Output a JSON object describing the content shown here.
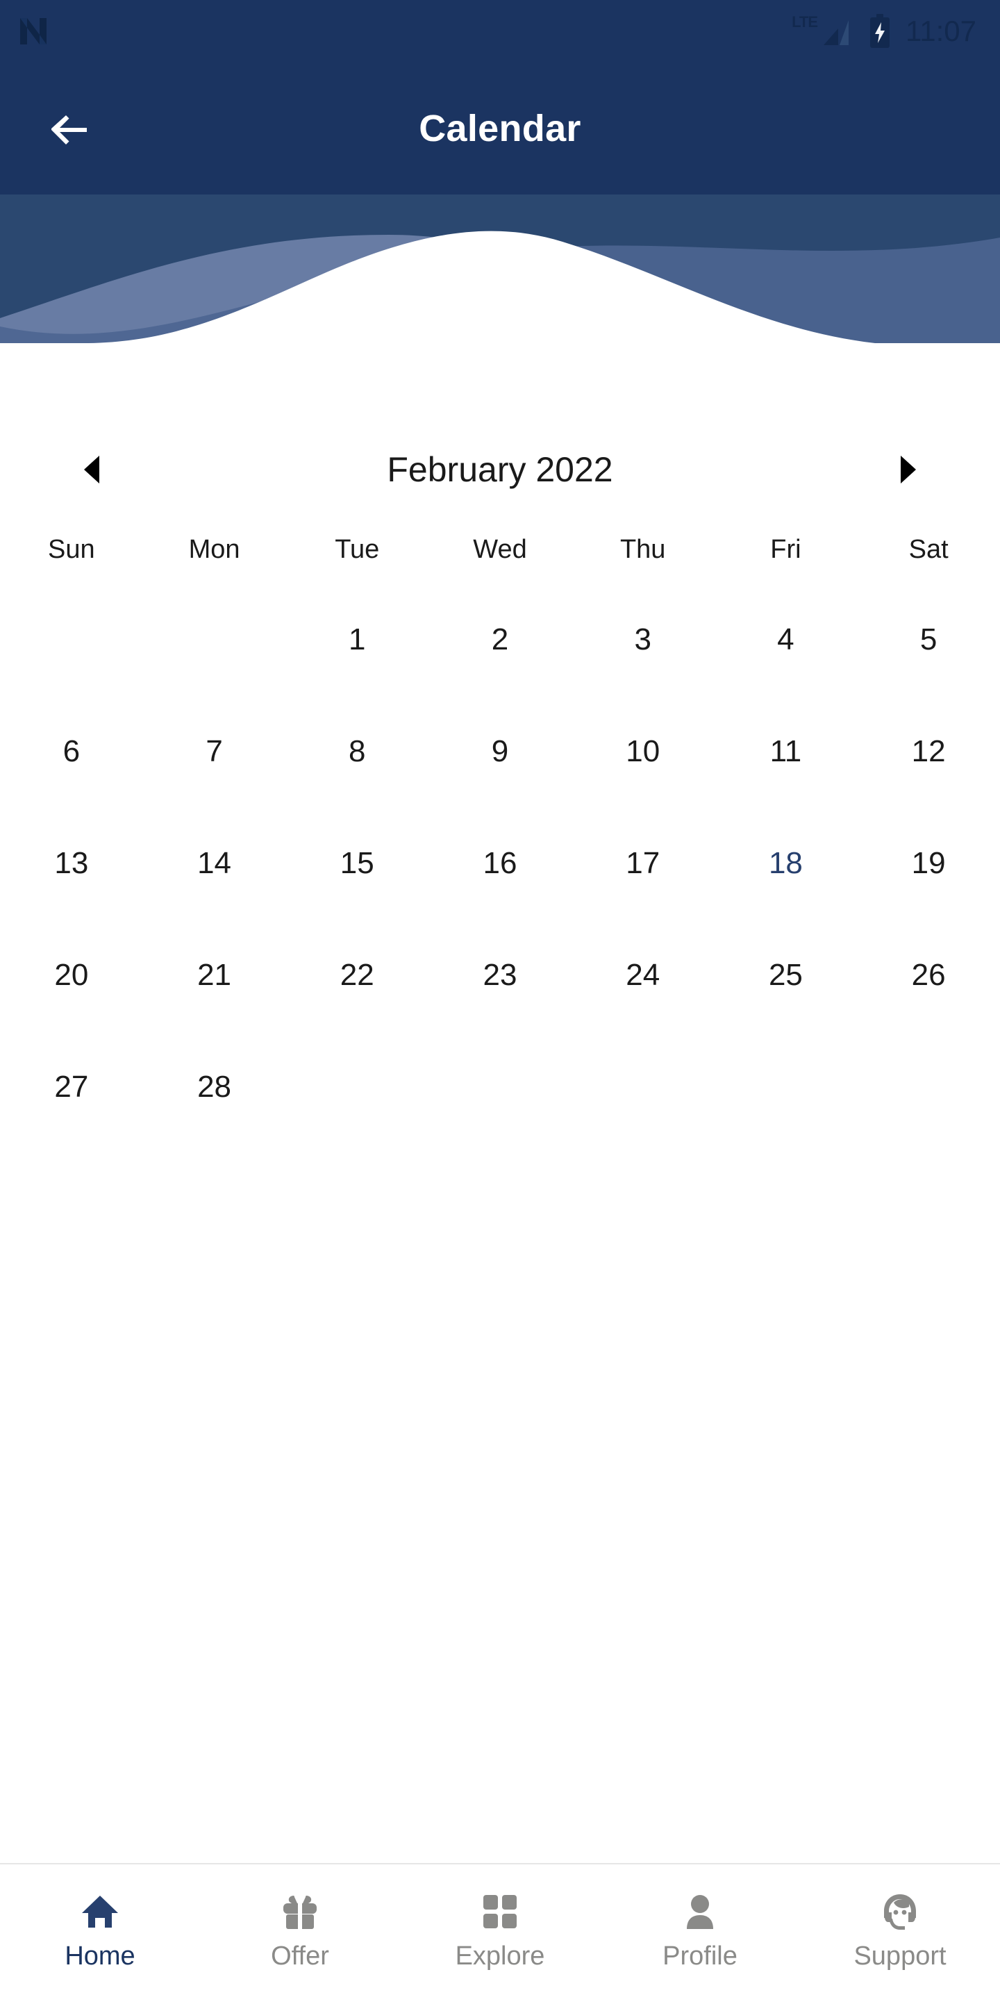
{
  "theme": {
    "app_bar_color": "#1b3461",
    "wave_band_color": "#2b4870",
    "wave_light_color": "#6b80a6",
    "accent_color": "#27406e",
    "nav_inactive_color": "#8a8a88",
    "page_background": "#ffffff",
    "day_text_color": "#1a1a1a"
  },
  "status_bar": {
    "app_badge_icon": "n-logo-icon",
    "network_label": "LTE",
    "signal_icon": "signal-bars-icon",
    "battery_icon": "battery-charging-icon",
    "time": "11:07"
  },
  "app_bar": {
    "back_icon": "arrow-left-icon",
    "title": "Calendar"
  },
  "calendar": {
    "prev_icon": "triangle-left-icon",
    "next_icon": "triangle-right-icon",
    "month_label": "February 2022",
    "weekdays": [
      "Sun",
      "Mon",
      "Tue",
      "Wed",
      "Thu",
      "Fri",
      "Sat"
    ],
    "leading_blanks": 2,
    "days": [
      "1",
      "2",
      "3",
      "4",
      "5",
      "6",
      "7",
      "8",
      "9",
      "10",
      "11",
      "12",
      "13",
      "14",
      "15",
      "16",
      "17",
      "18",
      "19",
      "20",
      "21",
      "22",
      "23",
      "24",
      "25",
      "26",
      "27",
      "28"
    ],
    "today": "18"
  },
  "bottom_nav": {
    "items": [
      {
        "label": "Home",
        "icon": "home-icon",
        "active": true
      },
      {
        "label": "Offer",
        "icon": "gift-icon",
        "active": false
      },
      {
        "label": "Explore",
        "icon": "grid-icon",
        "active": false
      },
      {
        "label": "Profile",
        "icon": "person-icon",
        "active": false
      },
      {
        "label": "Support",
        "icon": "headset-icon",
        "active": false
      }
    ]
  }
}
